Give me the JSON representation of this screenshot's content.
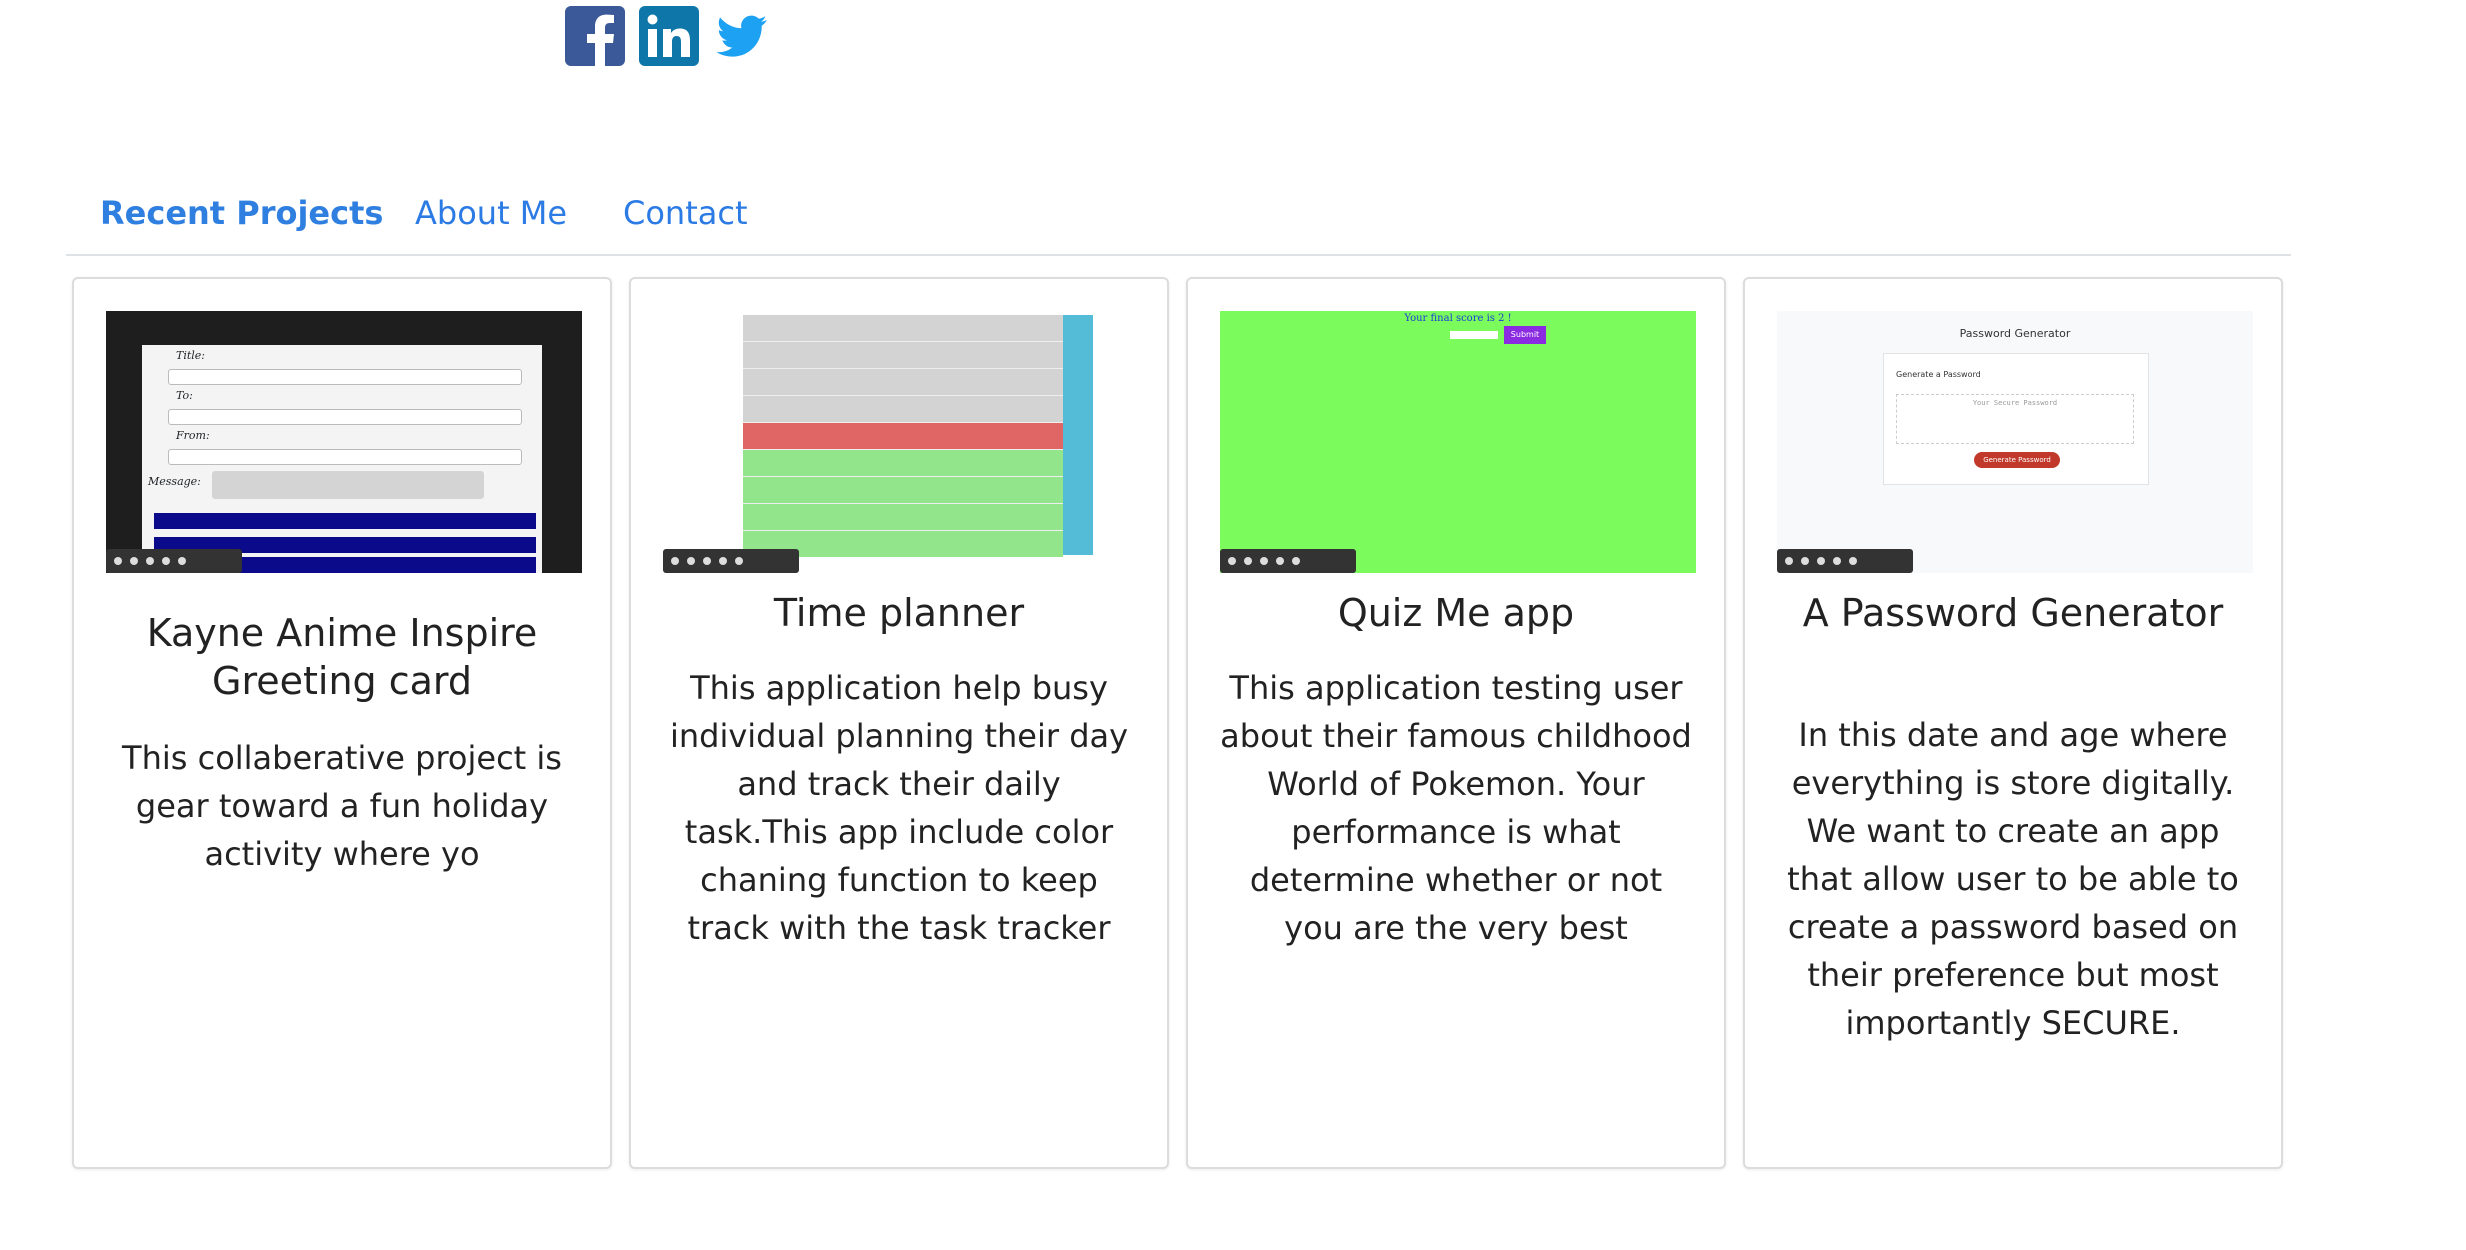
{
  "social": {
    "icons": [
      "facebook-icon",
      "linkedin-icon",
      "twitter-icon"
    ],
    "colors": {
      "facebook": "#3b5998",
      "linkedin": "#0e76a8",
      "twitter": "#1da1f2"
    }
  },
  "tabs": [
    {
      "label": "Recent Projects",
      "active": true
    },
    {
      "label": "About Me",
      "active": false
    },
    {
      "label": "Contact",
      "active": false
    }
  ],
  "colors": {
    "link": "#2c7be5",
    "quiz_green": "#7cfc5c",
    "planner_red": "#e06666",
    "planner_green": "#92e58a"
  },
  "projects": [
    {
      "title": "Kayne Anime Inspire Greeting card",
      "description": "This collaberative project is gear toward a fun holiday activity where yo",
      "thumb_fields": [
        "Title:",
        "To:",
        "From:",
        "Message:"
      ]
    },
    {
      "title": "Time planner",
      "description": "This application help busy individual planning their day and track their daily task.This app include color chaning function to keep track with the task tracker"
    },
    {
      "title": "Quiz Me app",
      "description": "This application testing user about their famous childhood World of Pokemon. Your performance is what determine whether or not you are the very best",
      "thumb_score": "Your final score is 2 !",
      "thumb_submit": "Submit"
    },
    {
      "title": "A Password Generator",
      "description": "In this date and age where everything is store digitally. We want to create an app that allow user to be able to create a password based on their preference but most importantly SECURE.",
      "thumb_heading": "Password Generator",
      "thumb_subheading": "Generate a Password",
      "thumb_placeholder": "Your Secure Password",
      "thumb_button": "Generate Password"
    }
  ]
}
